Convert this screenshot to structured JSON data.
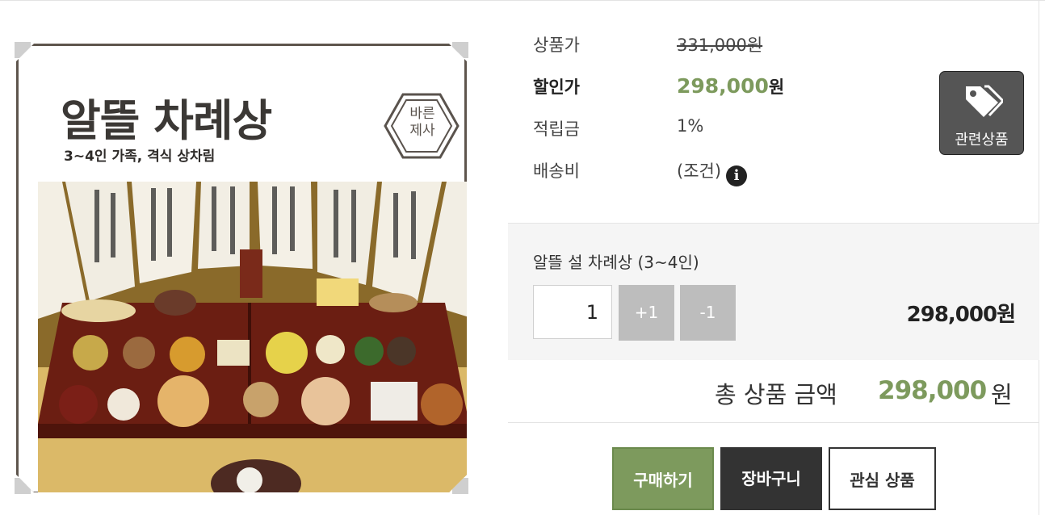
{
  "product_image": {
    "title": "알뜰 차례상",
    "subtitle": "3~4인 가족, 격식 상차림",
    "badge": [
      "바른",
      "제사"
    ]
  },
  "info": {
    "list_price_label": "상품가",
    "list_price": "331,000원",
    "sale_price_label": "할인가",
    "sale_price": "298,000",
    "sale_price_unit": "원",
    "points_label": "적립금",
    "points": "1%",
    "shipping_label": "배송비",
    "shipping": "(조건)",
    "shipping_info_icon": "i"
  },
  "related_button": {
    "label": "관련상품",
    "icon": "tag-icon"
  },
  "option": {
    "name": "알뜰 설 차례상 (3~4인)",
    "quantity": "1",
    "plus_label": "+1",
    "minus_label": "-1",
    "price": "298,000원"
  },
  "total": {
    "label": "총 상품 금액",
    "amount": "298,000",
    "unit": "원"
  },
  "actions": {
    "buy": "구매하기",
    "cart": "장바구니",
    "wishlist": "관심 상품"
  },
  "colors": {
    "accent_green": "#7d9a5d",
    "dark_button": "#333333",
    "qty_button": "#bdbdbd"
  }
}
